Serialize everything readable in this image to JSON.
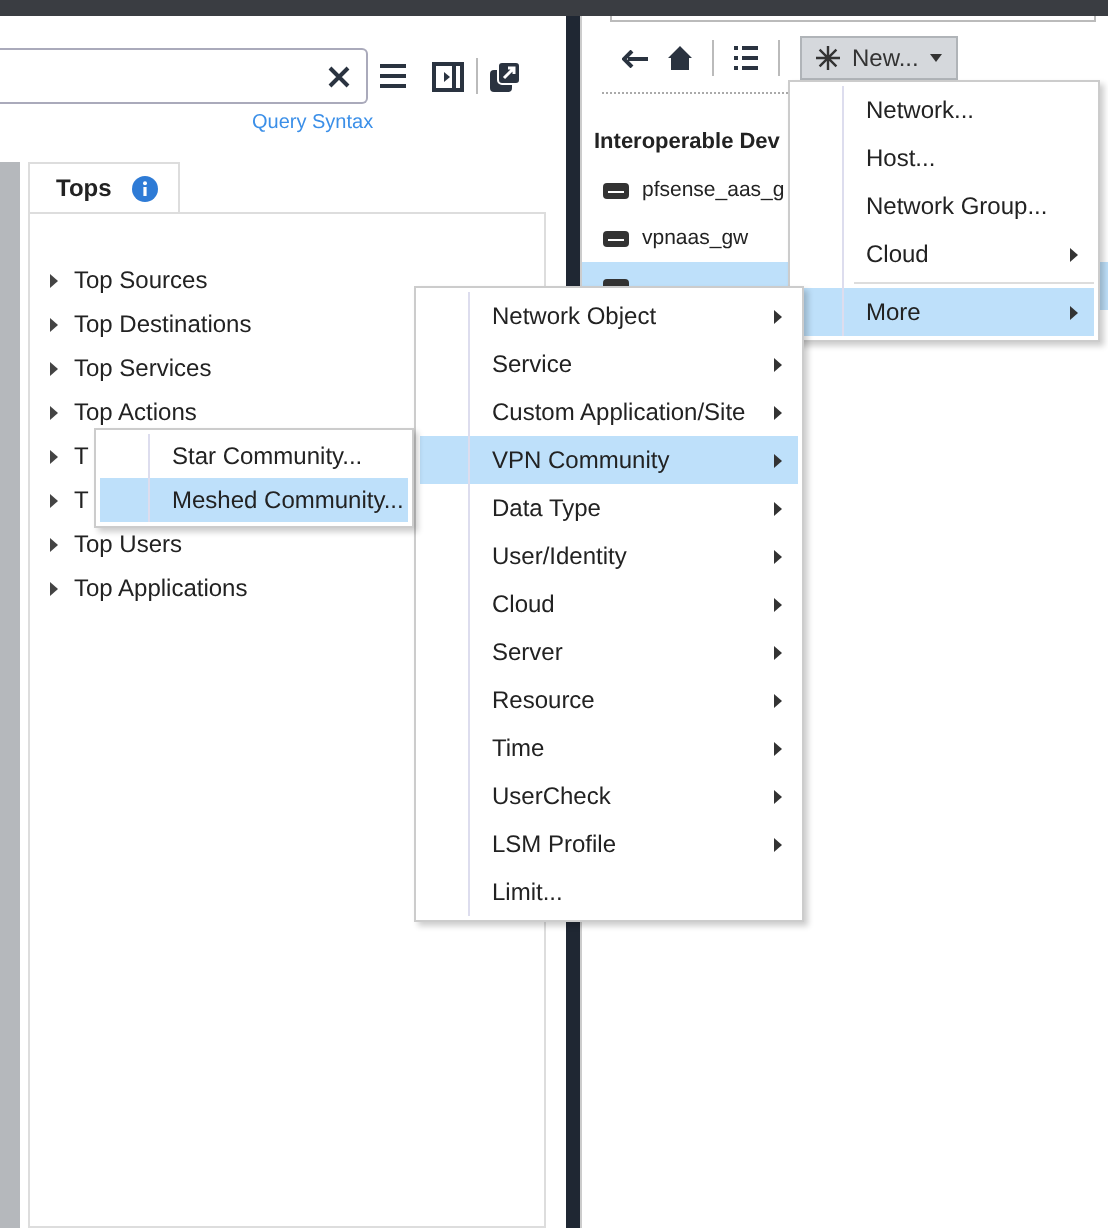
{
  "left_toolbar": {
    "query_link": "Query Syntax"
  },
  "tabs": [
    {
      "label": "Tops",
      "selected": true
    }
  ],
  "tops_tree": [
    {
      "label": "Top Sources"
    },
    {
      "label": "Top Destinations"
    },
    {
      "label": "Top Services"
    },
    {
      "label": "Top Actions"
    },
    {
      "label": "T"
    },
    {
      "label": "T"
    },
    {
      "label": "Top Users"
    },
    {
      "label": "Top Applications"
    }
  ],
  "right_toolbar": {
    "new_button": "New..."
  },
  "objects_panel": {
    "heading": "Interoperable Dev",
    "rows": [
      {
        "name": "pfsense_aas_g",
        "selected": false
      },
      {
        "name": "vpnaas_gw",
        "selected": false
      },
      {
        "name": "",
        "selected": true
      }
    ]
  },
  "new_menu": [
    {
      "label": "Network...",
      "submenu": false,
      "selected": false
    },
    {
      "label": "Host...",
      "submenu": false,
      "selected": false
    },
    {
      "label": "Network Group...",
      "submenu": false,
      "selected": false
    },
    {
      "label": "Cloud",
      "submenu": true,
      "selected": false
    },
    {
      "kind": "separator"
    },
    {
      "label": "More",
      "submenu": true,
      "selected": true
    }
  ],
  "more_menu": [
    {
      "label": "Network Object",
      "submenu": true,
      "selected": false
    },
    {
      "label": "Service",
      "submenu": true,
      "selected": false
    },
    {
      "label": "Custom Application/Site",
      "submenu": true,
      "selected": false
    },
    {
      "label": "VPN Community",
      "submenu": true,
      "selected": true
    },
    {
      "label": "Data Type",
      "submenu": true,
      "selected": false
    },
    {
      "label": "User/Identity",
      "submenu": true,
      "selected": false
    },
    {
      "label": "Cloud",
      "submenu": true,
      "selected": false
    },
    {
      "label": "Server",
      "submenu": true,
      "selected": false
    },
    {
      "label": "Resource",
      "submenu": true,
      "selected": false
    },
    {
      "label": "Time",
      "submenu": true,
      "selected": false
    },
    {
      "label": "UserCheck",
      "submenu": true,
      "selected": false
    },
    {
      "label": "LSM Profile",
      "submenu": true,
      "selected": false
    },
    {
      "label": "Limit...",
      "submenu": false,
      "selected": false
    }
  ],
  "vpn_menu": [
    {
      "label": "Star Community...",
      "submenu": false,
      "selected": false
    },
    {
      "label": "Meshed Community...",
      "submenu": false,
      "selected": true
    }
  ]
}
